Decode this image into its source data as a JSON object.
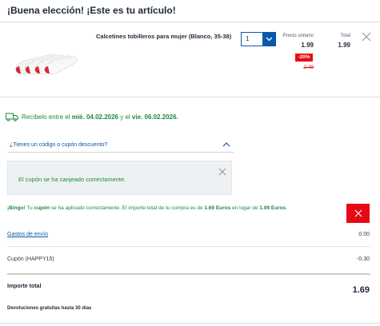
{
  "header": {
    "title": "¡Buena elección! ¡Este es tu artículo!"
  },
  "product": {
    "name": "Calcetines tobilleros para mujer (Blanco, 35-38)",
    "quantity": "1",
    "unit_price_label": "Precio unitario",
    "unit_price": "1.99",
    "discount_badge": "-20%",
    "old_price": "2.49",
    "total_label": "Total",
    "total": "1.99"
  },
  "delivery": {
    "prefix": "Recíbelo entre el",
    "date_from": "mié. 04.02.2026",
    "middle": "y el",
    "date_to": "vie. 06.02.2026",
    "suffix": "."
  },
  "coupon": {
    "toggle_label": "¿Tienes un código o cupón descuento?",
    "success_message": "El cupón se ha canjeado correctamente."
  },
  "bingo": {
    "bold1": "¡Bingo!",
    "text1": " Tu ",
    "bold2": "cupón",
    "text2": " se ha aplicado correctamente. El importe total de tu compra es de ",
    "bold3": "1.69 Euros",
    "text3": " en lugar de ",
    "bold4": "1.99 Euros",
    "text4": "."
  },
  "summary": {
    "shipping_label": "Gastos de envío",
    "shipping_value": "0.00",
    "coupon_label": "Cupón (HAPPY15)",
    "coupon_value": "-0.30",
    "total_label": "Importe total",
    "total_value": "1.69",
    "returns_note": "Devoluciones gratuitas hasta 30 días"
  },
  "colors": {
    "accent_blue": "#0a58a8",
    "success_green": "#1e8a3e",
    "discount_red": "#e60a14"
  },
  "icons": [
    "truck-icon",
    "chevron-down-icon",
    "chevron-up-icon",
    "close-icon",
    "delete-icon"
  ]
}
